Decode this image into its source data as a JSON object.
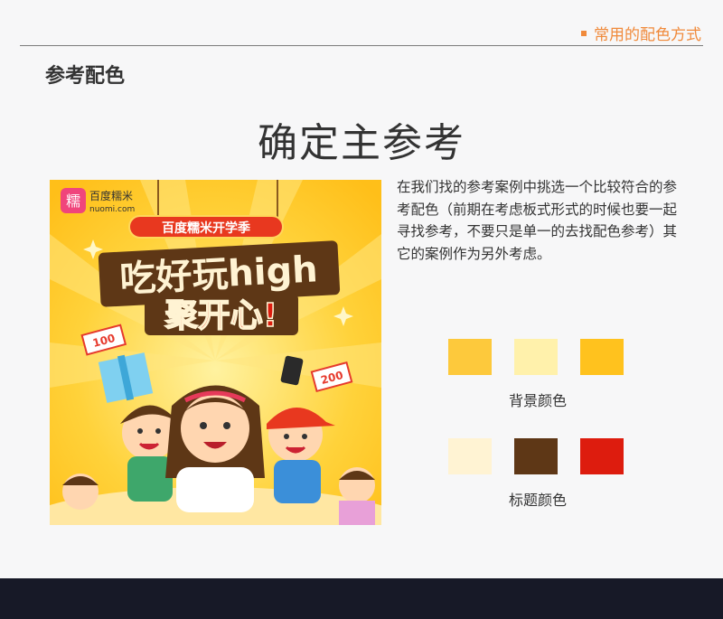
{
  "nav": {
    "label": "常用的配色方式"
  },
  "section_title": "参考配色",
  "main_title": "确定主参考",
  "description": "在我们找的参考案例中挑选一个比较符合的参考配色（前期在考虑板式形式的时候也要一起寻找参考，不要只是单一的去找配色参考）其它的案例作为另外考虑。",
  "poster": {
    "brand_name": "百度糯米",
    "brand_domain": "nuomi.com",
    "brand_char": "糯",
    "badge": "百度糯米开学季",
    "headline_line1": "吃好玩high",
    "headline_line2": "聚开心!",
    "tag_100": "100",
    "tag_200": "200"
  },
  "palettes": [
    {
      "label": "背景颜色",
      "colors": [
        "#fdc93c",
        "#fff1ab",
        "#ffc21e"
      ]
    },
    {
      "label": "标题颜色",
      "colors": [
        "#fff3d3",
        "#5e3716",
        "#dd1c0e"
      ]
    }
  ]
}
